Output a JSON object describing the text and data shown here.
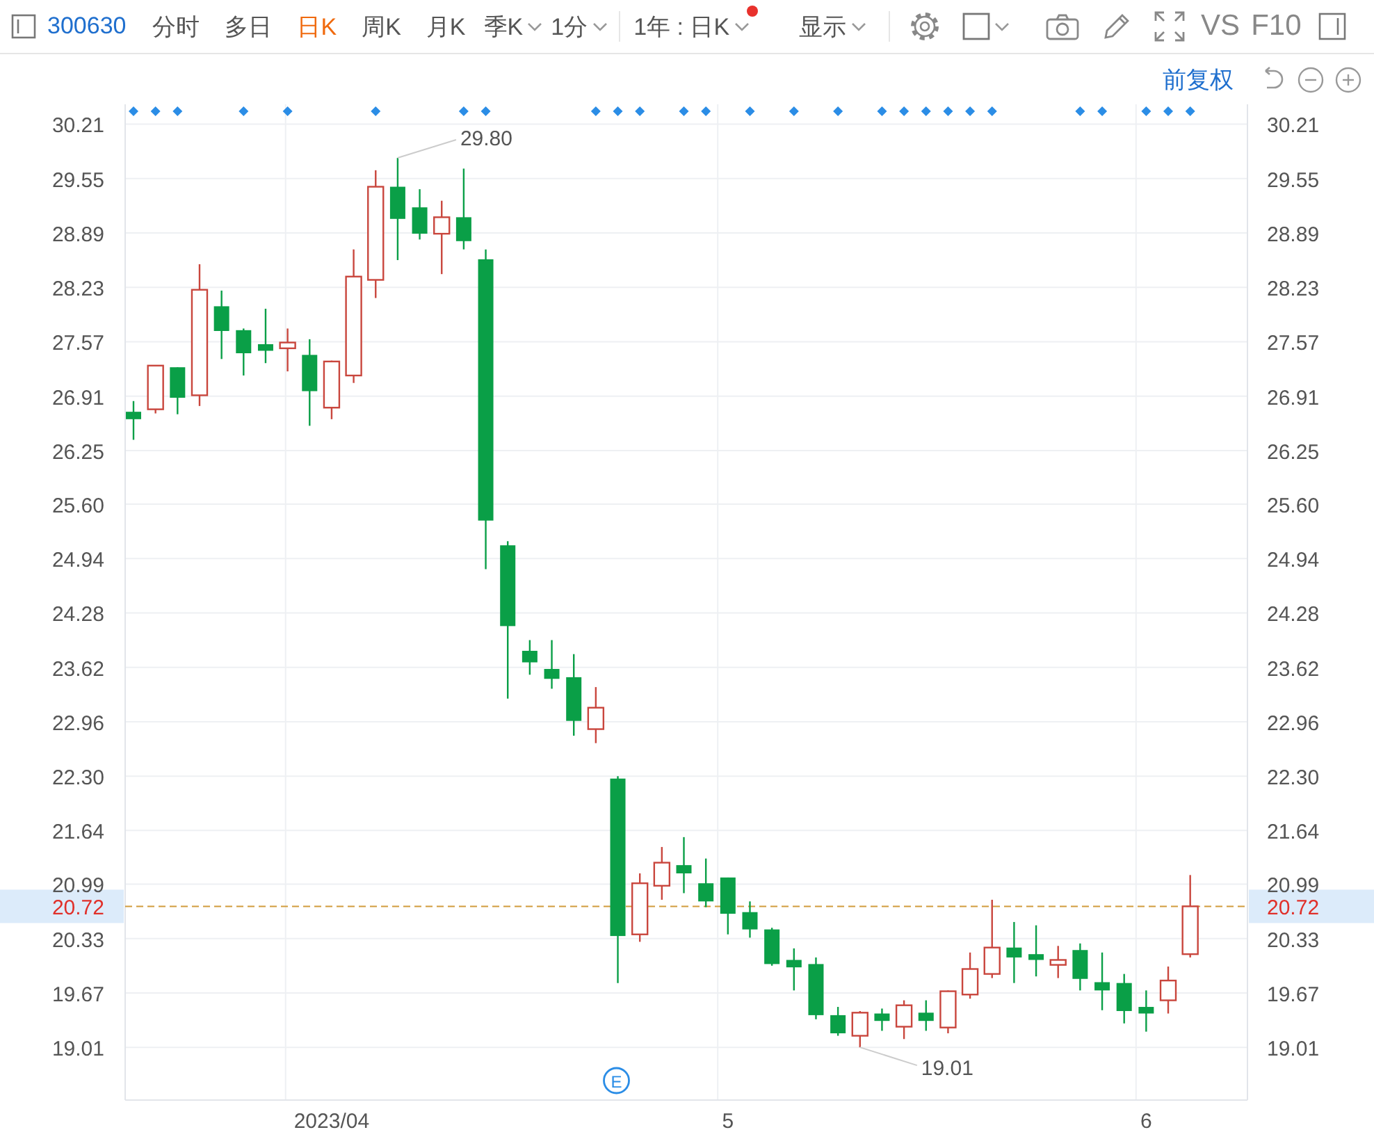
{
  "toolbar": {
    "code": "300630",
    "periods": [
      {
        "label": "分时",
        "selected": false,
        "kind": "tab"
      },
      {
        "label": "多日",
        "selected": false,
        "kind": "tab"
      },
      {
        "label": "日K",
        "selected": true,
        "kind": "tab"
      },
      {
        "label": "周K",
        "selected": false,
        "kind": "tab"
      },
      {
        "label": "月K",
        "selected": false,
        "kind": "tab"
      },
      {
        "label": "季K",
        "selected": false,
        "kind": "dropdown"
      },
      {
        "label": "1分",
        "selected": false,
        "kind": "dropdown"
      }
    ],
    "range": {
      "label": "1年 : 日K",
      "notification": true
    },
    "display": {
      "label": "显示"
    },
    "compare": "VS",
    "f10": "F10"
  },
  "chart": {
    "adjustment": "前复权",
    "right_axis_labels": [
      "30.21",
      "29.55",
      "28.89",
      "28.23",
      "27.57",
      "26.91",
      "26.25",
      "25.60",
      "24.94",
      "24.28",
      "23.62",
      "22.96",
      "22.30",
      "21.64",
      "20.99",
      "20.33",
      "19.67",
      "19.01"
    ],
    "right_price_label": "20.72",
    "event_flags": [
      true,
      true,
      true,
      false,
      false,
      true,
      false,
      true,
      false,
      false,
      false,
      true,
      false,
      false,
      false,
      true,
      true,
      false,
      false,
      false,
      false,
      true,
      true,
      true,
      false,
      true,
      true,
      false,
      true,
      false,
      true,
      false,
      true,
      false,
      true,
      true,
      true,
      true,
      true,
      true,
      false,
      false,
      false,
      true,
      true,
      false,
      true,
      true,
      true
    ],
    "chart_data": {
      "type": "candlestick",
      "ylim": [
        18.37,
        30.45
      ],
      "grid": true,
      "categories": [
        null,
        null,
        null,
        null,
        null,
        null,
        null,
        null,
        null,
        "2023/04",
        null,
        null,
        null,
        null,
        null,
        null,
        null,
        null,
        null,
        null,
        null,
        null,
        null,
        null,
        null,
        null,
        null,
        "5",
        null,
        null,
        null,
        null,
        null,
        null,
        null,
        null,
        null,
        null,
        null,
        null,
        null,
        null,
        null,
        null,
        null,
        null,
        "6",
        null,
        null
      ],
      "yticks": [
        {
          "value": 19.01,
          "label": "19.01"
        },
        {
          "value": 19.67,
          "label": "19.67"
        },
        {
          "value": 20.33,
          "label": "20.33"
        },
        {
          "value": 20.99,
          "label": "20.99"
        },
        {
          "value": 21.64,
          "label": "21.64"
        },
        {
          "value": 22.3,
          "label": "22.30"
        },
        {
          "value": 22.96,
          "label": "22.96"
        },
        {
          "value": 23.62,
          "label": "23.62"
        },
        {
          "value": 24.28,
          "label": "24.28"
        },
        {
          "value": 24.94,
          "label": "24.94"
        },
        {
          "value": 25.6,
          "label": "25.60"
        },
        {
          "value": 26.25,
          "label": "26.25"
        },
        {
          "value": 26.91,
          "label": "26.91"
        },
        {
          "value": 27.57,
          "label": "27.57"
        },
        {
          "value": 28.23,
          "label": "28.23"
        },
        {
          "value": 28.89,
          "label": "28.89"
        },
        {
          "value": 29.55,
          "label": "29.55"
        },
        {
          "value": 30.21,
          "label": "30.21"
        }
      ],
      "ohlc": [
        [
          26.72,
          26.85,
          26.38,
          26.63
        ],
        [
          26.75,
          27.28,
          26.7,
          27.28
        ],
        [
          27.26,
          27.26,
          26.69,
          26.89
        ],
        [
          26.92,
          28.51,
          26.79,
          28.2
        ],
        [
          28.0,
          28.19,
          27.36,
          27.7
        ],
        [
          27.71,
          27.73,
          27.16,
          27.43
        ],
        [
          27.54,
          27.97,
          27.31,
          27.46
        ],
        [
          27.49,
          27.73,
          27.21,
          27.56
        ],
        [
          27.41,
          27.6,
          26.55,
          26.97
        ],
        [
          26.77,
          27.34,
          26.63,
          27.33
        ],
        [
          27.16,
          28.69,
          27.07,
          28.36
        ],
        [
          28.32,
          29.65,
          28.1,
          29.45
        ],
        [
          29.45,
          29.8,
          28.56,
          29.06
        ],
        [
          29.2,
          29.42,
          28.81,
          28.88
        ],
        [
          28.88,
          29.28,
          28.39,
          29.08
        ],
        [
          29.08,
          29.67,
          28.69,
          28.79
        ],
        [
          28.57,
          28.69,
          24.81,
          25.4
        ],
        [
          25.1,
          25.15,
          23.24,
          24.12
        ],
        [
          23.82,
          23.95,
          23.53,
          23.68
        ],
        [
          23.6,
          23.95,
          23.36,
          23.48
        ],
        [
          23.5,
          23.78,
          22.79,
          22.97
        ],
        [
          22.87,
          23.38,
          22.7,
          23.13
        ],
        [
          22.27,
          22.3,
          19.79,
          20.36
        ],
        [
          20.38,
          21.12,
          20.29,
          21.0
        ],
        [
          20.97,
          21.44,
          20.8,
          21.25
        ],
        [
          21.22,
          21.56,
          20.88,
          21.12
        ],
        [
          21.0,
          21.3,
          20.71,
          20.78
        ],
        [
          21.07,
          21.07,
          20.38,
          20.63
        ],
        [
          20.65,
          20.78,
          20.34,
          20.44
        ],
        [
          20.44,
          20.46,
          20.0,
          20.02
        ],
        [
          20.07,
          20.21,
          19.7,
          19.98
        ],
        [
          20.02,
          20.1,
          19.35,
          19.4
        ],
        [
          19.4,
          19.5,
          19.15,
          19.18
        ],
        [
          19.15,
          19.45,
          19.01,
          19.43
        ],
        [
          19.42,
          19.48,
          19.21,
          19.33
        ],
        [
          19.26,
          19.58,
          19.11,
          19.52
        ],
        [
          19.43,
          19.58,
          19.21,
          19.33
        ],
        [
          19.25,
          19.7,
          19.18,
          19.69
        ],
        [
          19.65,
          20.16,
          19.6,
          19.96
        ],
        [
          19.9,
          20.8,
          19.85,
          20.22
        ],
        [
          20.22,
          20.53,
          19.79,
          20.1
        ],
        [
          20.14,
          20.49,
          19.87,
          20.07
        ],
        [
          20.01,
          20.24,
          19.85,
          20.07
        ],
        [
          20.19,
          20.27,
          19.7,
          19.84
        ],
        [
          19.8,
          20.16,
          19.46,
          19.7
        ],
        [
          19.79,
          19.9,
          19.3,
          19.45
        ],
        [
          19.5,
          19.7,
          19.2,
          19.42
        ],
        [
          19.58,
          19.99,
          19.42,
          19.82
        ],
        [
          20.14,
          21.1,
          20.1,
          20.72
        ]
      ],
      "ref_lines": [
        {
          "axis": "y",
          "value": 20.72,
          "label": "20.72"
        }
      ],
      "annotations": [
        "29.80",
        "19.01",
        "E"
      ]
    }
  }
}
